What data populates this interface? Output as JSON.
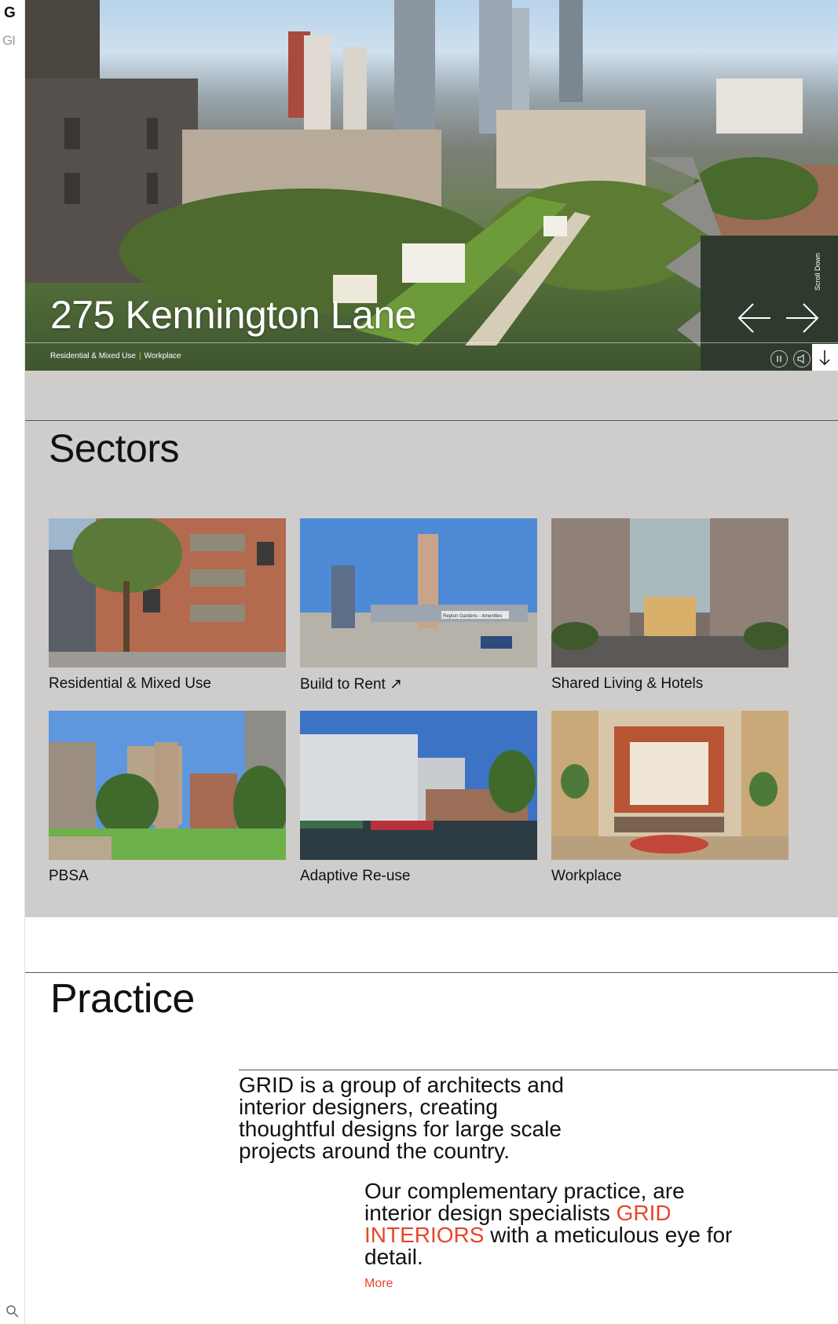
{
  "brand": {
    "logo_primary": "G",
    "logo_secondary": "GI"
  },
  "hero": {
    "title": "275 Kennington Lane",
    "tags": [
      "Residential & Mixed Use",
      "Workplace"
    ],
    "tag_separator": "|",
    "scroll_label": "Scroll Down"
  },
  "sectors": {
    "heading": "Sectors",
    "items": [
      {
        "label": "Residential & Mixed Use"
      },
      {
        "label": "Build to Rent ↗"
      },
      {
        "label": "Shared Living & Hotels"
      },
      {
        "label": "PBSA"
      },
      {
        "label": "Adaptive Re-use"
      },
      {
        "label": "Workplace"
      }
    ],
    "sign_text": "Repton Gardens - Amenities"
  },
  "practice": {
    "heading": "Practice",
    "intro": "GRID is a group of architects and interior designers, creating thoughtful designs for large scale projects around the country.",
    "secondary_before": "Our complementary practice, are interior design specialists ",
    "secondary_accent": "GRID INTERIORS",
    "secondary_after": " with a meticulous eye for detail.",
    "more_label": "More"
  },
  "colors": {
    "accent": "#e8452c",
    "sectors_bg": "#cfcdcb",
    "tag_separator": "#9fd05a"
  },
  "icons": {
    "search": "search-icon",
    "prev": "arrow-left-icon",
    "next": "arrow-right-icon",
    "scroll": "arrow-down-icon"
  }
}
